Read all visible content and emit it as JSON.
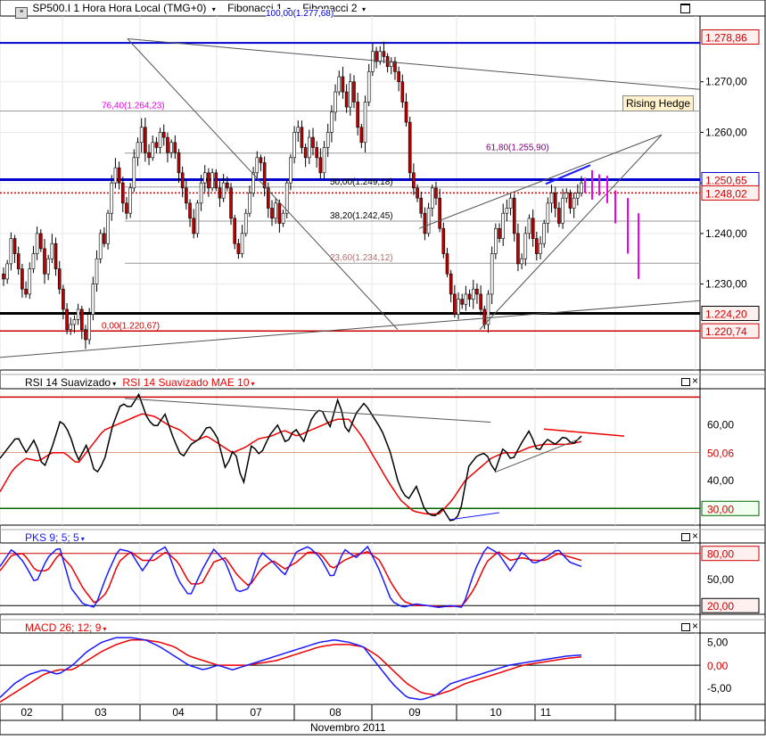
{
  "header": {
    "title": "SP500.I 1 Hora Hora Local (TMG+0)",
    "fib1": "Fibonacci 1",
    "fib2": "Fibonacci 2",
    "fib_top_label": "100,00(1.277,68)"
  },
  "axis": {
    "x_month_label": "Novembro 2011",
    "x_ticks": [
      "02",
      "03",
      "04",
      "07",
      "08",
      "09",
      "10",
      "11"
    ]
  },
  "colors": {
    "up": "#ffffff",
    "down": "#c00000",
    "wick": "#000000",
    "fib": "#999999",
    "blue_level": "#0000cc",
    "red_level": "#cc0000",
    "projection": "#ee00ee",
    "rsi_main": "#000000",
    "rsi_ma": "#ee0000",
    "pks_k": "#1a1aff",
    "pks_d": "#ee0000",
    "macd": "#1a1aff",
    "macd_signal": "#ee0000"
  },
  "chart_data": [
    {
      "type": "candlestick",
      "title": "SP500.I 1 Hora Hora Local (TMG+0)",
      "ylim": [
        1213,
        1283
      ],
      "y_ticks": [
        1230,
        1240,
        1250,
        1260,
        1270
      ],
      "y_tick_labels": [
        "1.230,00",
        "1.240,00",
        "1.250,00",
        "1.260,00",
        "1.270,00"
      ],
      "price_boxes": [
        {
          "value": 1278.86,
          "label": "1.278,86",
          "style": "red"
        },
        {
          "value": 1250.65,
          "label": "1.250,65",
          "style": "blue"
        },
        {
          "value": 1248.02,
          "label": "1.248,02",
          "style": "red"
        },
        {
          "value": 1224.2,
          "label": "1.224,20",
          "style": "black"
        },
        {
          "value": 1220.74,
          "label": "1.220,74",
          "style": "red"
        }
      ],
      "fibonacci": [
        {
          "level": 100.0,
          "price": 1277.68,
          "label": "100,00(1.277,68)",
          "color": "#0000cc"
        },
        {
          "level": 76.4,
          "price": 1264.23,
          "label": "76,40(1.264,23)",
          "color": "#ee00ee"
        },
        {
          "level": 61.8,
          "price": 1255.9,
          "label": "61,80(1.255,90)",
          "color": "#800080"
        },
        {
          "level": 50.0,
          "price": 1249.18,
          "label": "50,00(1.249,18)",
          "color": "#000000"
        },
        {
          "level": 38.2,
          "price": 1242.45,
          "label": "38,20(1.242,45)",
          "color": "#000000"
        },
        {
          "level": 23.6,
          "price": 1234.12,
          "label": "23,60(1.234,12)",
          "color": "#b07070"
        },
        {
          "level": 0.0,
          "price": 1220.67,
          "label": "0,00(1.220,67)",
          "color": "#cc0000"
        }
      ],
      "annotations": [
        "Rising Hedge"
      ],
      "ohlc_close": [
        1231,
        1234,
        1239,
        1236,
        1233,
        1229,
        1228,
        1233,
        1236,
        1240,
        1237,
        1232,
        1235,
        1238,
        1233,
        1229,
        1225,
        1221,
        1222,
        1223,
        1225,
        1221,
        1219,
        1224,
        1230,
        1235,
        1240,
        1238,
        1244,
        1250,
        1253,
        1250,
        1246,
        1244,
        1249,
        1255,
        1258,
        1261,
        1256,
        1255,
        1258,
        1257,
        1260,
        1259,
        1256,
        1258,
        1256,
        1252,
        1249,
        1246,
        1243,
        1240,
        1246,
        1250,
        1252,
        1249,
        1252,
        1249,
        1247,
        1250,
        1249,
        1243,
        1238,
        1236,
        1240,
        1244,
        1248,
        1252,
        1255,
        1254,
        1249,
        1245,
        1243,
        1246,
        1242,
        1244,
        1250,
        1255,
        1260,
        1261,
        1257,
        1255,
        1259,
        1257,
        1255,
        1252,
        1257,
        1260,
        1264,
        1268,
        1271,
        1268,
        1265,
        1270,
        1266,
        1261,
        1258,
        1266,
        1272,
        1276,
        1274,
        1276,
        1275,
        1273,
        1274,
        1272,
        1270,
        1266,
        1262,
        1252,
        1249,
        1247,
        1244,
        1240,
        1245,
        1249,
        1247,
        1241,
        1236,
        1232,
        1228,
        1224,
        1227,
        1226,
        1228,
        1227,
        1229,
        1228,
        1225,
        1222,
        1228,
        1236,
        1241,
        1239,
        1244,
        1245,
        1247,
        1240,
        1234,
        1235,
        1240,
        1243,
        1239,
        1236,
        1238,
        1242,
        1246,
        1248,
        1245,
        1242,
        1247,
        1248,
        1245,
        1247,
        1248,
        1250
      ]
    },
    {
      "type": "line",
      "title": "RSI 14 Suavizado",
      "series": [
        {
          "name": "RSI 14 Suavizado"
        },
        {
          "name": "RSI 14 Suavizado MAE 10"
        }
      ],
      "ylim": [
        24,
        73
      ],
      "y_ticks": [
        40,
        60
      ],
      "y_tick_labels": [
        "40,00",
        "60,00"
      ],
      "levels": [
        {
          "value": 30,
          "label": "30,00"
        },
        {
          "value": 70,
          "label": ""
        }
      ],
      "last_value": {
        "value": 50.06,
        "label": "50,06"
      }
    },
    {
      "type": "line",
      "title": "PKS 9; 5; 5",
      "ylim": [
        10,
        92
      ],
      "y_ticks": [
        50
      ],
      "y_tick_labels": [
        "50,00"
      ],
      "levels": [
        {
          "value": 80,
          "label": "80,00"
        },
        {
          "value": 20,
          "label": "20,00"
        }
      ]
    },
    {
      "type": "line",
      "title": "MACD 26; 12; 9",
      "ylim": [
        -8.5,
        7
      ],
      "y_ticks": [
        5,
        -5
      ],
      "y_tick_labels": [
        "5,00",
        "-5,00"
      ],
      "zero_label": "0,00"
    }
  ]
}
